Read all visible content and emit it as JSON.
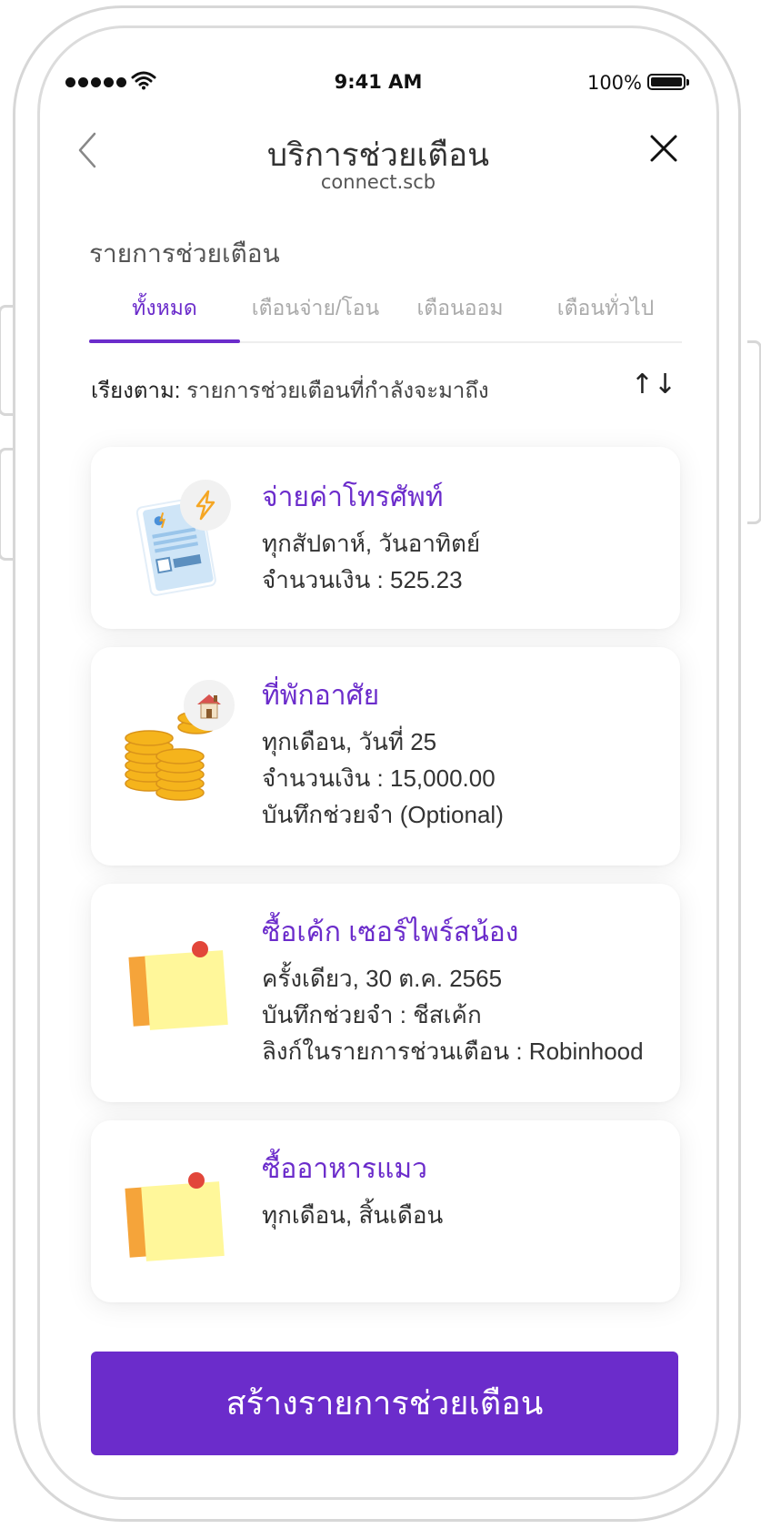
{
  "status_bar": {
    "time": "9:41 AM",
    "battery": "100%"
  },
  "header": {
    "title": "บริการช่วยเตือน",
    "subtitle": "connect.scb"
  },
  "section_title": "รายการช่วยเตือน",
  "tabs": [
    {
      "label": "ทั้งหมด",
      "active": true
    },
    {
      "label": "เตือนจ่าย/โอน",
      "active": false
    },
    {
      "label": "เตือนออม",
      "active": false
    },
    {
      "label": "เตือนทั่วไป",
      "active": false
    }
  ],
  "sort": {
    "prefix": "เรียงตาม:",
    "value": "รายการช่วยเตือนที่กำลังจะมาถึง"
  },
  "reminders": [
    {
      "title": "จ่ายค่าโทรศัพท์",
      "lines": [
        "ทุกสัปดาห์, วันอาทิตย์",
        "จำนวนเงิน : 525.23"
      ],
      "icon": "bill-icon",
      "badge_icon": "lightning-icon"
    },
    {
      "title": "ที่พักอาศัย",
      "lines": [
        "ทุกเดือน, วันที่ 25",
        "จำนวนเงิน : 15,000.00",
        "บันทึกช่วยจำ (Optional)"
      ],
      "icon": "coins-icon",
      "badge_icon": "house-icon"
    },
    {
      "title": "ซื้อเค้ก เซอร์ไพร์สน้อง",
      "lines": [
        "ครั้งเดียว, 30 ต.ค. 2565",
        "บันทึกช่วยจำ : ชีสเค้ก",
        "ลิงก์ในรายการช่วนเตือน : Robinhood"
      ],
      "icon": "sticky-note-icon"
    },
    {
      "title": "ซื้ออาหารแมว",
      "lines": [
        "ทุกเดือน, สิ้นเดือน"
      ],
      "icon": "sticky-note-icon"
    }
  ],
  "cta_label": "สร้างรายการช่วยเตือน",
  "colors": {
    "accent": "#6b2ccb"
  }
}
